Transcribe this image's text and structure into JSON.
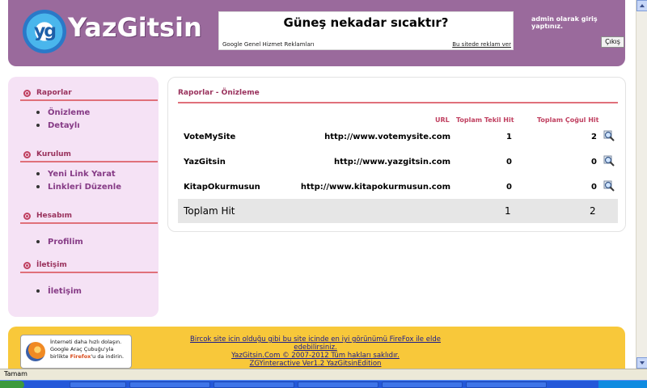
{
  "header": {
    "logo_text": "YazGitsin",
    "logo_mark": "yg",
    "ad_title": "Güneş nekadar sıcaktır?",
    "ad_left": "Google Genel Hizmet Reklamları",
    "ad_right": "Bu sitede reklam ver",
    "user_text": "admin olarak giriş yaptınız.",
    "logout_label": "Çıkış"
  },
  "sidebar": {
    "sections": [
      {
        "title": "Raporlar",
        "items": [
          "Önizleme",
          "Detaylı"
        ]
      },
      {
        "title": "Kurulum",
        "items": [
          "Yeni Link Yarat",
          "Linkleri Düzenle"
        ]
      },
      {
        "title": "Hesabım",
        "items": [
          "Profilim"
        ]
      },
      {
        "title": "İletişim",
        "items": [
          "İletişim"
        ]
      }
    ]
  },
  "main": {
    "title": "Raporlar - Önizleme",
    "columns": {
      "url": "URL",
      "tekil": "Toplam Tekil Hit",
      "cogul": "Toplam Çoğul Hit"
    },
    "rows": [
      {
        "name": "VoteMySite",
        "url": "http://www.votemysite.com",
        "tekil": "1",
        "cogul": "2"
      },
      {
        "name": "YazGitsin",
        "url": "http://www.yazgitsin.com",
        "tekil": "0",
        "cogul": "0"
      },
      {
        "name": "KitapOkurmusun",
        "url": "http://www.kitapokurmusun.com",
        "tekil": "0",
        "cogul": "0"
      }
    ],
    "total": {
      "label": "Toplam Hit",
      "tekil": "1",
      "cogul": "2"
    }
  },
  "footer": {
    "ff_line1": "İnterneti daha hızlı dolaşın.",
    "ff_line2": "Google Araç Çubuğu'yla",
    "ff_line3_pre": "birlikte ",
    "ff_line3_brand": "Firefox",
    "ff_line3_post": "'u da indirin.",
    "line1": "Bircok site icin olduğu gibi bu site icinde en iyi görünümü FireFox ile elde edebilirsiniz.",
    "line2": "YazGitsin.Com © 2007-2012 Tüm hakları saklıdır.",
    "line3": "ZGYinteractive Ver1.2 YazGitsinEdition"
  },
  "status": {
    "text": "Tamam"
  },
  "colors": {
    "header": "#9a6a9c",
    "sidebar": "#f5e2f5",
    "accent": "#c04060",
    "footer": "#f8c83a"
  }
}
